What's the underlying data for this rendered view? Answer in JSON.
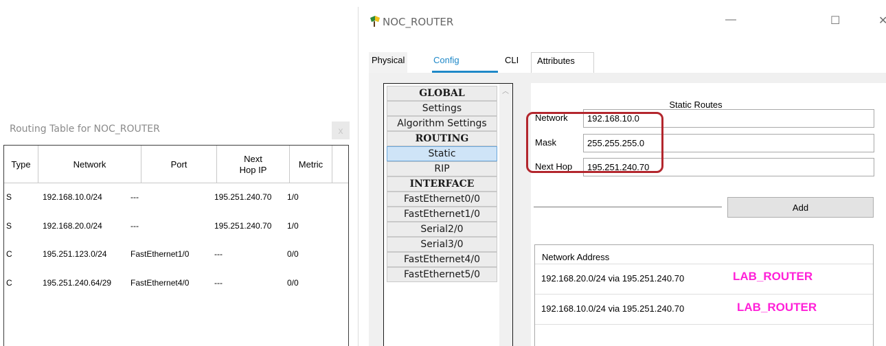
{
  "routing_table": {
    "title": "Routing Table for NOC_ROUTER",
    "close_label": "x",
    "columns": [
      "Type",
      "Network",
      "Port",
      "Next Hop IP",
      "Metric"
    ],
    "rows": [
      {
        "type": "S",
        "network": "192.168.10.0/24",
        "port": "---",
        "next_hop": "195.251.240.70",
        "metric": "1/0"
      },
      {
        "type": "S",
        "network": "192.168.20.0/24",
        "port": "---",
        "next_hop": "195.251.240.70",
        "metric": "1/0"
      },
      {
        "type": "C",
        "network": "195.251.123.0/24",
        "port": "FastEthernet1/0",
        "next_hop": "---",
        "metric": "0/0"
      },
      {
        "type": "C",
        "network": "195.251.240.64/29",
        "port": "FastEthernet4/0",
        "next_hop": "---",
        "metric": "0/0"
      }
    ]
  },
  "router_window": {
    "title": "NOC_ROUTER",
    "controls": {
      "minimize": "—",
      "maximize": "☐",
      "close": "✕"
    },
    "tabs": [
      "Physical",
      "Config",
      "CLI",
      "Attributes"
    ],
    "active_tab": "Config",
    "config_list": [
      {
        "label": "GLOBAL",
        "kind": "header"
      },
      {
        "label": "Settings",
        "kind": "item"
      },
      {
        "label": "Algorithm Settings",
        "kind": "item"
      },
      {
        "label": "ROUTING",
        "kind": "header"
      },
      {
        "label": "Static",
        "kind": "selected"
      },
      {
        "label": "RIP",
        "kind": "item"
      },
      {
        "label": "INTERFACE",
        "kind": "header"
      },
      {
        "label": "FastEthernet0/0",
        "kind": "item"
      },
      {
        "label": "FastEthernet1/0",
        "kind": "item"
      },
      {
        "label": "Serial2/0",
        "kind": "item"
      },
      {
        "label": "Serial3/0",
        "kind": "item"
      },
      {
        "label": "FastEthernet4/0",
        "kind": "item"
      },
      {
        "label": "FastEthernet5/0",
        "kind": "item"
      }
    ],
    "static_routes": {
      "heading": "Static Routes",
      "network_label": "Network",
      "network_value": "192.168.10.0",
      "mask_label": "Mask",
      "mask_value": "255.255.255.0",
      "next_hop_label": "Next Hop",
      "next_hop_value": "195.251.240.70",
      "add_label": "Add",
      "list_header": "Network Address",
      "entries": [
        {
          "text": "192.168.20.0/24 via 195.251.240.70",
          "tag": "LAB_ROUTER"
        },
        {
          "text": "192.168.10.0/24 via 195.251.240.70",
          "tag": "LAB_ROUTER"
        }
      ]
    }
  },
  "colors": {
    "accent": "#1e88c8",
    "annotation_tag": "#ff20d8",
    "highlight_box": "#b3262d"
  }
}
